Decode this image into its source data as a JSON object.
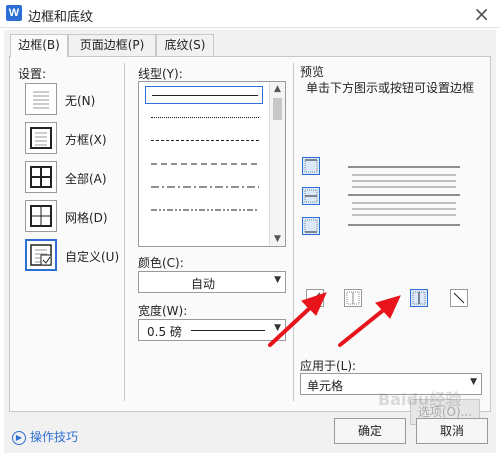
{
  "window": {
    "title": "边框和底纹",
    "app_icon_letter": "W"
  },
  "tabs": [
    {
      "label": "边框(B)",
      "active": true
    },
    {
      "label": "页面边框(P)",
      "active": false
    },
    {
      "label": "底纹(S)",
      "active": false
    }
  ],
  "settings": {
    "label": "设置:",
    "options": [
      {
        "label": "无(N)",
        "icon": "none-border-icon",
        "selected": false
      },
      {
        "label": "方框(X)",
        "icon": "box-border-icon",
        "selected": false
      },
      {
        "label": "全部(A)",
        "icon": "all-borders-icon",
        "selected": false
      },
      {
        "label": "网格(D)",
        "icon": "grid-border-icon",
        "selected": false
      },
      {
        "label": "自定义(U)",
        "icon": "custom-border-icon",
        "selected": true
      }
    ]
  },
  "line_style": {
    "label": "线型(Y):",
    "items": [
      "solid",
      "dotted",
      "dashed-small",
      "dash",
      "dash-dot",
      "dash-dot-dot"
    ]
  },
  "color": {
    "label": "颜色(C):",
    "value": "自动"
  },
  "width": {
    "label": "宽度(W):",
    "value": "0.5 磅"
  },
  "preview": {
    "label": "预览",
    "hint": "单击下方图示或按钮可设置边框"
  },
  "apply_to": {
    "label": "应用于(L):",
    "value": "单元格"
  },
  "buttons": {
    "options": "选项(O)...",
    "ok": "确定",
    "cancel": "取消"
  },
  "tips": {
    "label": "操作技巧"
  },
  "watermark": "Baidu经验",
  "colors": {
    "accent": "#2d6fd3",
    "arrow": "#e8141b"
  }
}
